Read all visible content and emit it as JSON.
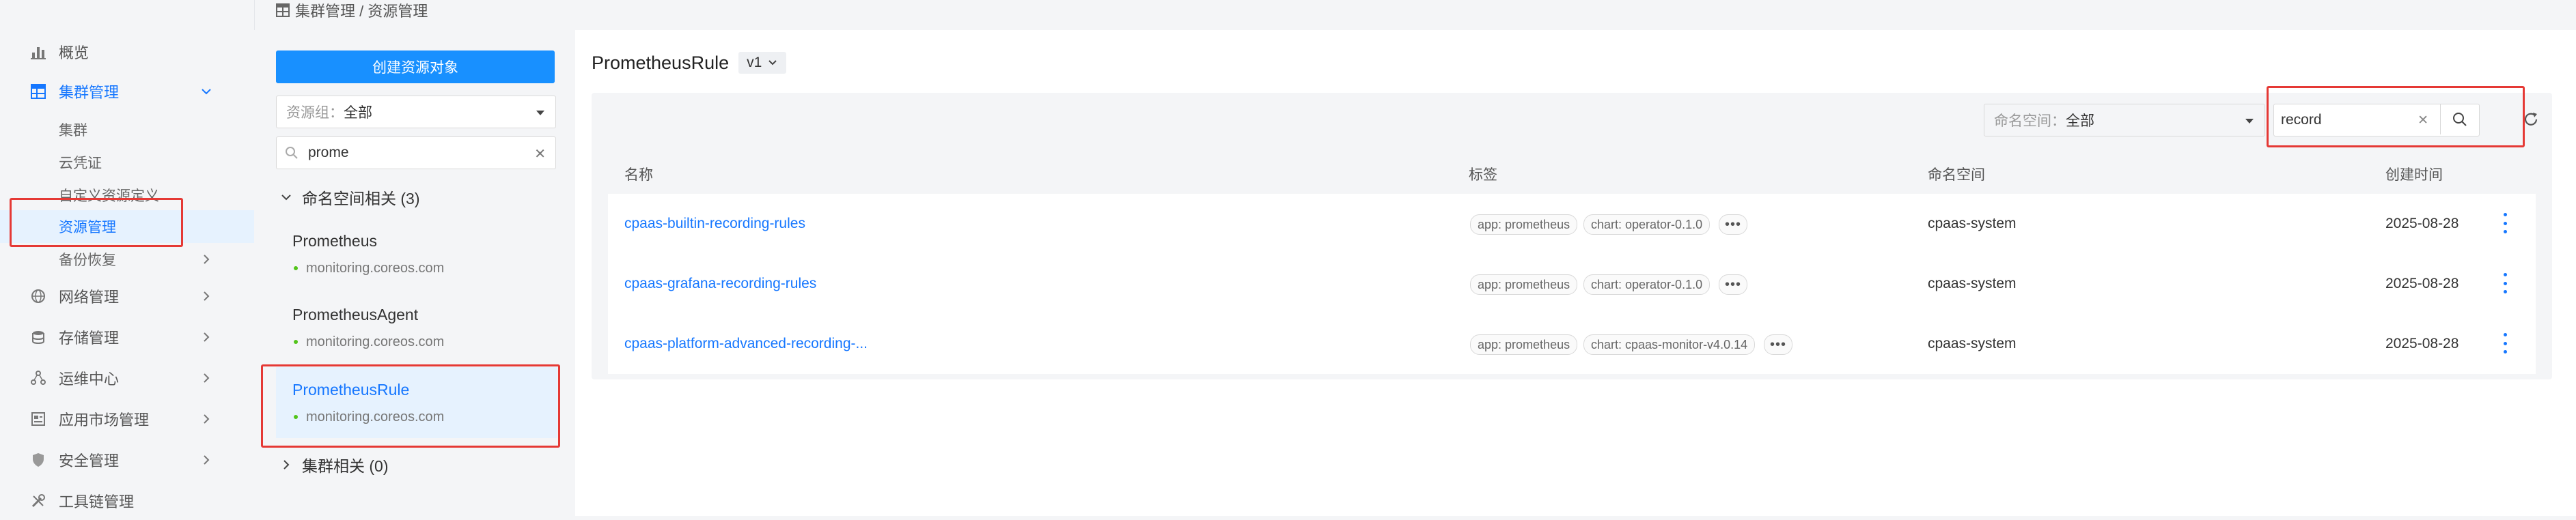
{
  "breadcrumb": "集群管理 / 资源管理",
  "sidebar": {
    "items": [
      {
        "label": "概览"
      },
      {
        "label": "集群管理"
      },
      {
        "label": "网络管理"
      },
      {
        "label": "存储管理"
      },
      {
        "label": "运维中心"
      },
      {
        "label": "应用市场管理"
      },
      {
        "label": "安全管理"
      },
      {
        "label": "工具链管理"
      }
    ],
    "sub_items": [
      {
        "label": "集群"
      },
      {
        "label": "云凭证"
      },
      {
        "label": "自定义资源定义"
      },
      {
        "label": "资源管理"
      },
      {
        "label": "备份恢复"
      }
    ]
  },
  "middle": {
    "create_button": "创建资源对象",
    "resource_group_prefix": "资源组：",
    "resource_group_value": "全部",
    "search_value": "prome",
    "namespace_group_label": "命名空间相关 (3)",
    "resources": [
      {
        "name": "Prometheus",
        "group": "monitoring.coreos.com"
      },
      {
        "name": "PrometheusAgent",
        "group": "monitoring.coreos.com"
      },
      {
        "name": "PrometheusRule",
        "group": "monitoring.coreos.com"
      }
    ],
    "cluster_group_label": "集群相关 (0)"
  },
  "main": {
    "title": "PrometheusRule",
    "version": "v1",
    "namespace_prefix": "命名空间：",
    "namespace_value": "全部",
    "search_value": "record",
    "columns": [
      "名称",
      "标签",
      "命名空间",
      "创建时间"
    ],
    "rows": [
      {
        "name": "cpaas-builtin-recording-rules",
        "tags": [
          "app: prometheus",
          "chart: operator-0.1.0"
        ],
        "namespace": "cpaas-system",
        "created": "2025-08-28"
      },
      {
        "name": "cpaas-grafana-recording-rules",
        "tags": [
          "app: prometheus",
          "chart: operator-0.1.0"
        ],
        "namespace": "cpaas-system",
        "created": "2025-08-28"
      },
      {
        "name": "cpaas-platform-advanced-recording-...",
        "tags": [
          "app: prometheus",
          "chart: cpaas-monitor-v4.0.14"
        ],
        "namespace": "cpaas-system",
        "created": "2025-08-28"
      }
    ]
  },
  "colors": {
    "accent": "#1890ff",
    "highlight": "#e53935",
    "selected_bg": "#e6f2fe"
  }
}
